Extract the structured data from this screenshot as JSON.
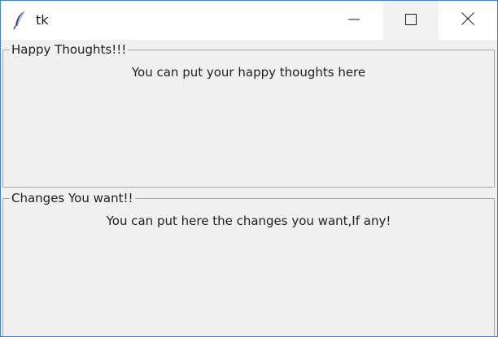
{
  "window": {
    "title": "tk",
    "icon": "tk-feather-icon",
    "controls": {
      "minimize_icon": "minimize-icon",
      "maximize_icon": "maximize-icon",
      "close_icon": "close-icon"
    }
  },
  "frames": [
    {
      "legend": "Happy Thoughts!!!",
      "text": "You can put your happy thoughts here"
    },
    {
      "legend": "Changes You want!!",
      "text": "You can put here the changes you want,If any!"
    }
  ],
  "colors": {
    "window_border": "#4a7fc1",
    "background": "#f0f0f0",
    "frame_border": "#a9a9a9"
  }
}
